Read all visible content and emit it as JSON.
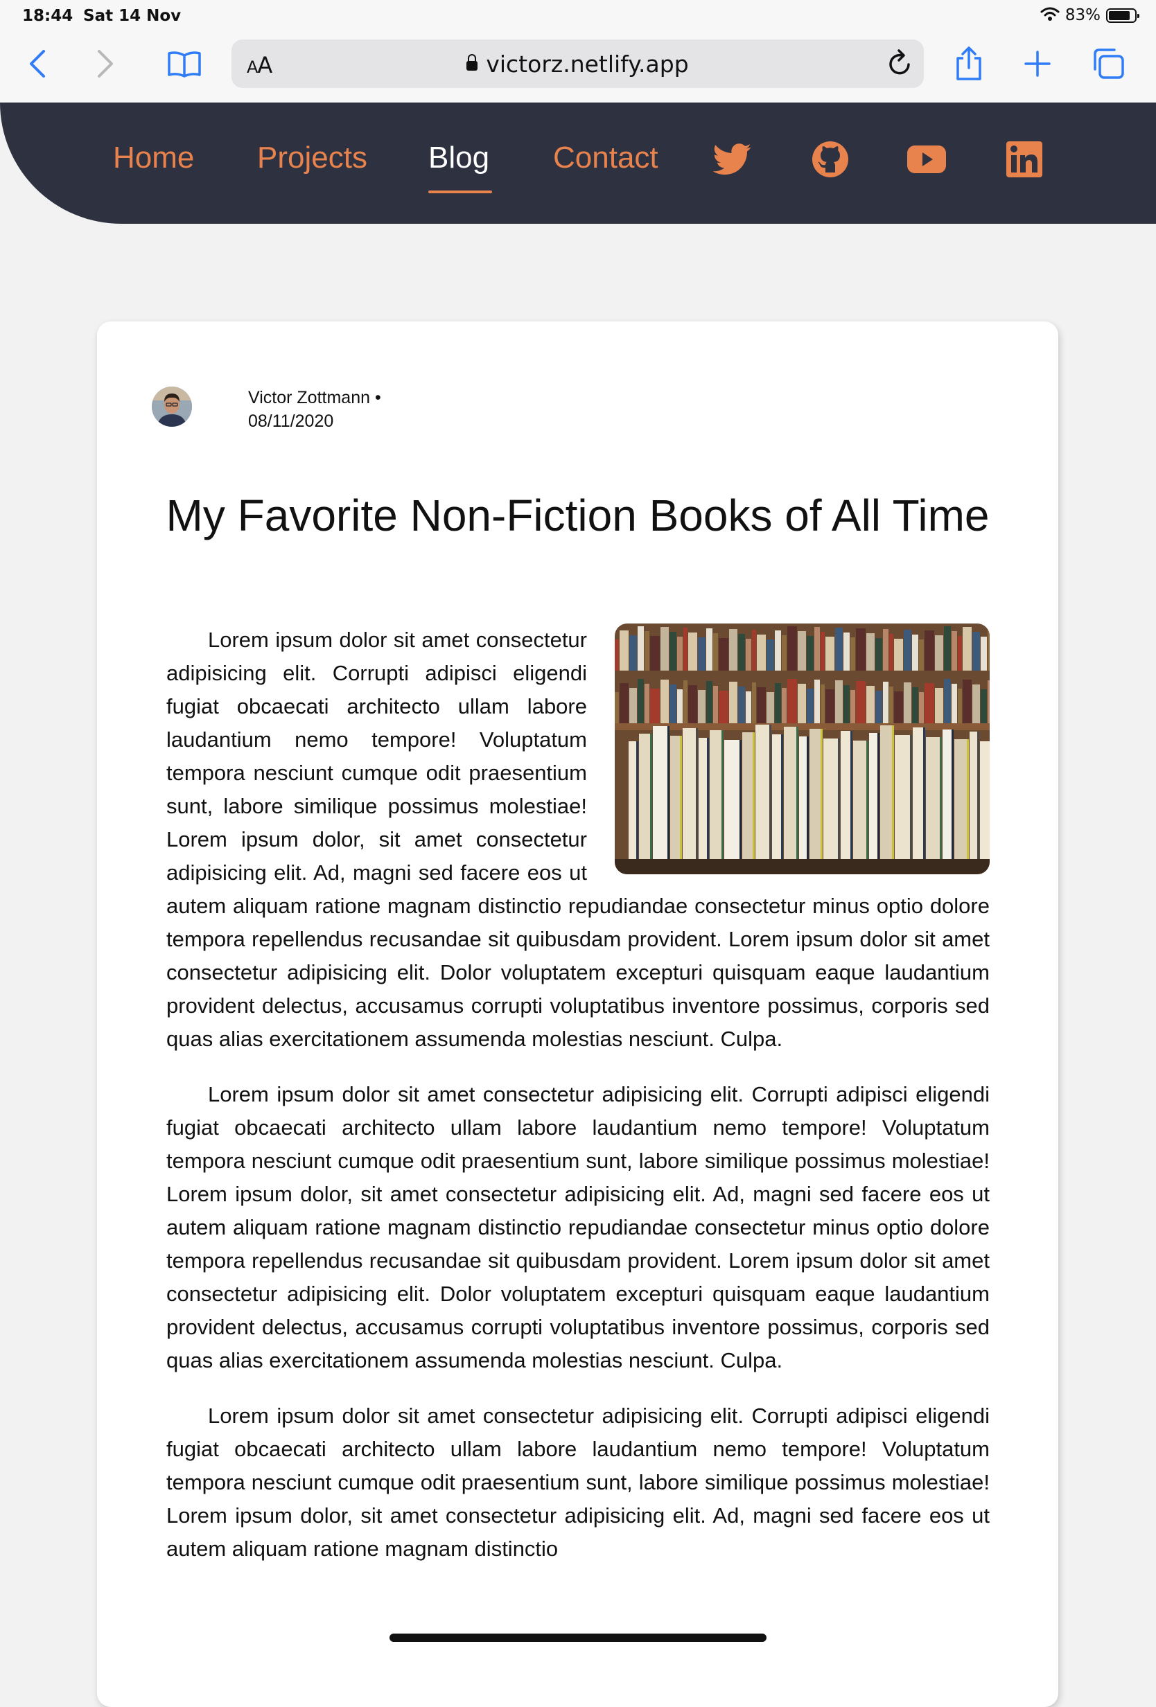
{
  "status_bar": {
    "time": "18:44",
    "date": "Sat 14 Nov",
    "battery": "83%",
    "battery_level": 0.83
  },
  "browser": {
    "text_size_label_big": "A",
    "text_size_label_small": "A",
    "url": "victorz.netlify.app",
    "icons": [
      "back-icon",
      "forward-icon",
      "bookmarks-icon",
      "lock-icon",
      "reload-icon",
      "share-icon",
      "new-tab-icon",
      "tabs-icon"
    ]
  },
  "nav": {
    "links": [
      {
        "label": "Home"
      },
      {
        "label": "Projects"
      },
      {
        "label": "Blog"
      },
      {
        "label": "Contact"
      }
    ],
    "active": "Blog",
    "social_icons": [
      "twitter-icon",
      "github-icon",
      "youtube-icon",
      "linkedin-icon"
    ],
    "colors": {
      "bar": "#2e3140",
      "accent": "#e8834d"
    }
  },
  "post": {
    "author": "Victor Zottmann •",
    "date": "08/11/2020",
    "title": "My Favorite Non-Fiction Books of All Time",
    "paragraphs": [
      "Lorem ipsum dolor sit amet consectetur adipisicing elit. Corrupti adipisci eligendi fugiat obcaecati architecto ullam labore laudantium nemo tempore! Voluptatum tempora nesciunt cumque odit praesentium sunt, labore similique possimus molestiae! Lorem ipsum dolor, sit amet consectetur adipisicing elit. Ad, magni sed facere eos ut autem aliquam ratione magnam distinctio repudiandae consectetur minus optio dolore tempora repellendus recusandae sit quibusdam provident. Lorem ipsum dolor sit amet consectetur adipisicing elit. Dolor voluptatem excepturi quisquam eaque laudantium provident delectus, accusamus corrupti voluptatibus inventore possimus, corporis sed quas alias exercitationem assumenda molestias nesciunt. Culpa.",
      "Lorem ipsum dolor sit amet consectetur adipisicing elit. Corrupti adipisci eligendi fugiat obcaecati architecto ullam labore laudantium nemo tempore! Voluptatum tempora nesciunt cumque odit praesentium sunt, labore similique possimus molestiae! Lorem ipsum dolor, sit amet consectetur adipisicing elit. Ad, magni sed facere eos ut autem aliquam ratione magnam distinctio repudiandae consectetur minus optio dolore tempora repellendus recusandae sit quibusdam provident. Lorem ipsum dolor sit amet consectetur adipisicing elit. Dolor voluptatem excepturi quisquam eaque laudantium provident delectus, accusamus corrupti voluptatibus inventore possimus, corporis sed quas alias exercitationem assumenda molestias nesciunt. Culpa.",
      "Lorem ipsum dolor sit amet consectetur adipisicing elit. Corrupti adipisci eligendi fugiat obcaecati architecto ullam labore laudantium nemo tempore! Voluptatum tempora nesciunt cumque odit praesentium sunt, labore similique possimus molestiae! Lorem ipsum dolor, sit amet consectetur adipisicing elit. Ad, magni sed facere eos ut autem aliquam ratione magnam distinctio"
    ]
  }
}
